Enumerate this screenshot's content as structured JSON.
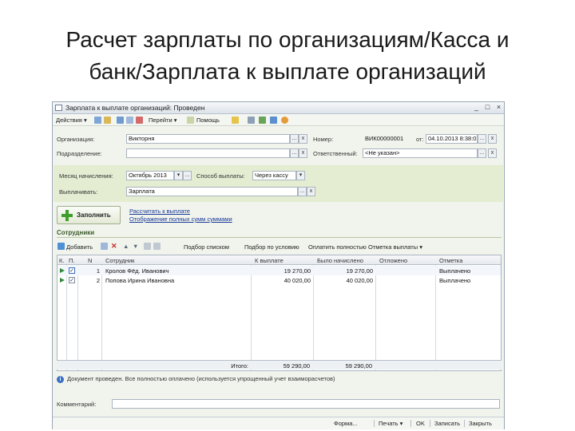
{
  "slide": {
    "title_line1": "Расчет зарплаты по организациям/Касса и",
    "title_line2": "банк/Зарплата к выплате организаций"
  },
  "window": {
    "title": "Зарплата к выплате организаций: Проведен",
    "min": "_",
    "max": "□",
    "close": "×"
  },
  "toolbar": {
    "actions": "Действия ▾",
    "goto": "Перейти ▾",
    "help": "Помощь"
  },
  "form": {
    "org_label": "Организация:",
    "org_value": "Викторня",
    "dept_label": "Подразделение:",
    "dept_value": "",
    "number_label": "Номер:",
    "number_value": "ВИК00000001",
    "from_label": "от:",
    "date_value": "04.10.2013 8:38:0",
    "resp_label": "Ответственный:",
    "resp_value": "<Не указан>",
    "month_label": "Месяц начисления:",
    "month_value": "Октябрь 2013",
    "method_label": "Способ выплаты:",
    "method_value": "Через кассу",
    "pay_label": "Выплачивать:",
    "pay_value": "Зарплата",
    "ellipsis": "...",
    "x": "x",
    "dropdown": "▾"
  },
  "fill": {
    "button_label": "Заполнить",
    "link1": "Рассчитать к выплате",
    "link2": "Отображение полных сумм суммами"
  },
  "employees": {
    "section_title": "Сотрудники",
    "add": "Добавить",
    "pick": "Подбор списком",
    "pick_cond": "Подбор по условию",
    "pay_all": "Оплатить полностью",
    "mark_pay": "Отметка выплаты ▾",
    "columns": [
      "К.",
      "П.",
      "N",
      "Сотрудник",
      "К выплате",
      "Было начислено",
      "Отложено",
      "Отметка"
    ],
    "rows": [
      {
        "n": "1",
        "employee": "Кролов Фёд. Иванович",
        "to_pay": "19 270,00",
        "accrued": "19 270,00",
        "deferred": "",
        "mark": "Выплачено"
      },
      {
        "n": "2",
        "employee": "Попова Ирина Ивановна",
        "to_pay": "40 020,00",
        "accrued": "40 020,00",
        "deferred": "",
        "mark": "Выплачено"
      }
    ],
    "totals_label": "Итого:",
    "totals_to_pay": "59 290,00",
    "totals_accrued": "59 290,00"
  },
  "info_text": "Документ проведен. Все полностью оплачено (используется упрощенный учет взаиморасчетов)",
  "comment_label": "Комментарий:",
  "comment_value": "",
  "bottom": {
    "form": "Форма...",
    "print": "Печать ▾",
    "ok": "OK",
    "save": "Записать",
    "close": "Закрыть"
  },
  "colors": {
    "accent_green": "#3f9f2a",
    "band": "#e4ecd2",
    "link": "#1a3a9a"
  }
}
